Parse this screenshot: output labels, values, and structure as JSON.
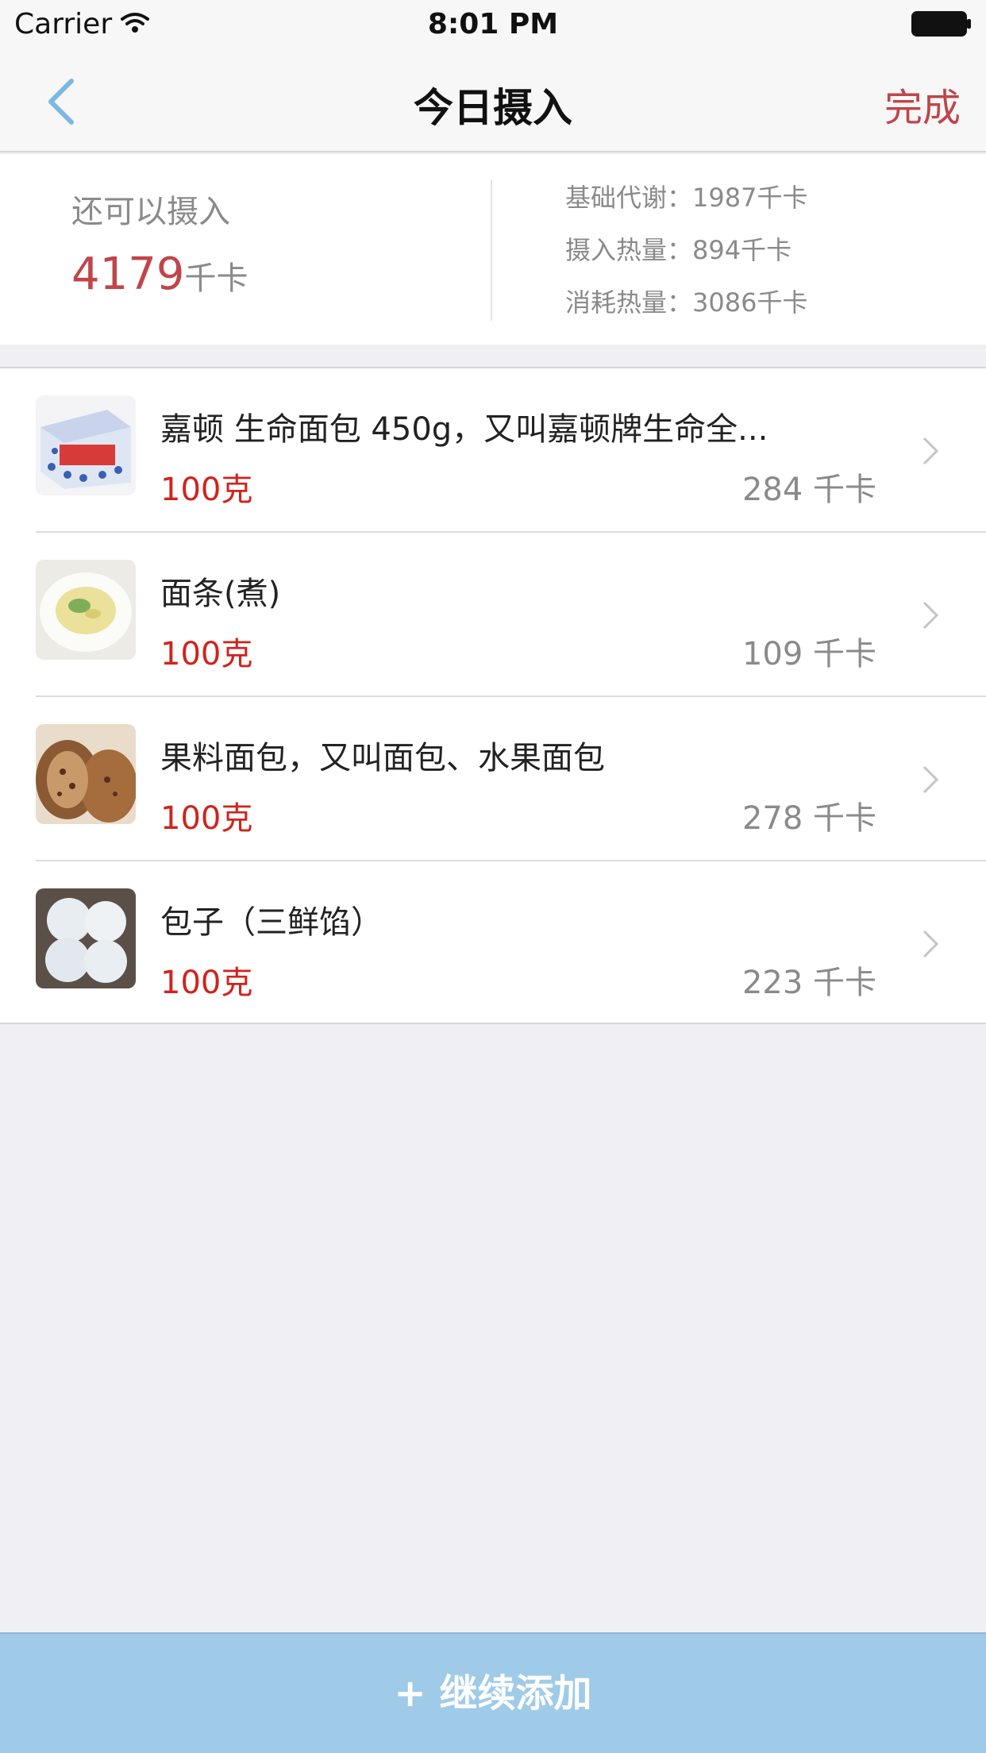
{
  "status_bar": {
    "carrier": "Carrier",
    "time": "8:01 PM"
  },
  "nav": {
    "title": "今日摄入",
    "done_label": "完成",
    "back_icon": "chevron-left-icon",
    "accent_color": "#c0454a",
    "back_color": "#7bb8e3"
  },
  "summary": {
    "remaining_label": "还可以摄入",
    "remaining_value": "4179",
    "remaining_unit": "千卡",
    "bmr": "基础代谢：1987千卡",
    "intake": "摄入热量：894千卡",
    "burned": "消耗热量：3086千卡"
  },
  "foods": [
    {
      "name": "嘉顿 生命面包 450g，又叫嘉顿牌生命全...",
      "amount": "100克",
      "kcal": "284 千卡"
    },
    {
      "name": "面条(煮)",
      "amount": "100克",
      "kcal": "109 千卡"
    },
    {
      "name": "果料面包，又叫面包、水果面包",
      "amount": "100克",
      "kcal": "278 千卡"
    },
    {
      "name": "包子（三鲜馅）",
      "amount": "100克",
      "kcal": "223 千卡"
    }
  ],
  "bottom": {
    "add_label": "+ 继续添加",
    "button_color": "#9fcbe9"
  }
}
